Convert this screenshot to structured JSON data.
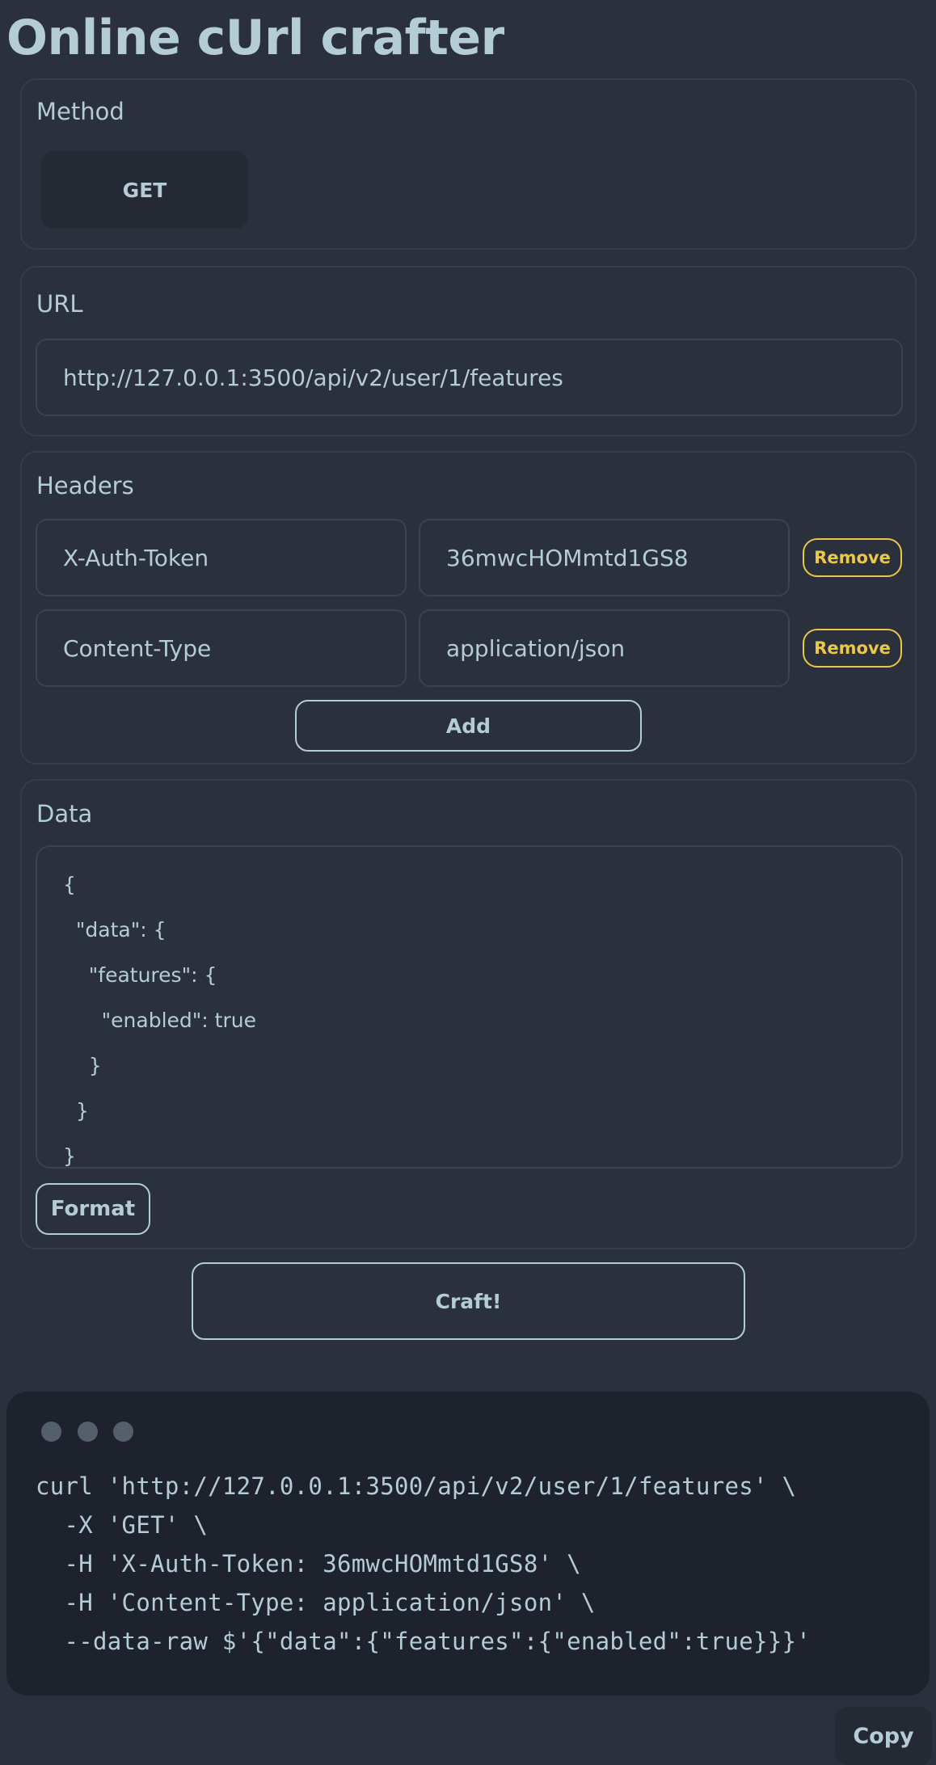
{
  "title": "Online cUrl crafter",
  "method": {
    "label": "Method",
    "selected": "GET"
  },
  "url": {
    "label": "URL",
    "value": "http://127.0.0.1:3500/api/v2/user/1/features"
  },
  "headers": {
    "label": "Headers",
    "rows": [
      {
        "key": "X-Auth-Token",
        "value": "36mwcHOMmtd1GS8",
        "remove_label": "Remove"
      },
      {
        "key": "Content-Type",
        "value": "application/json",
        "remove_label": "Remove"
      }
    ],
    "add_label": "Add"
  },
  "data": {
    "label": "Data",
    "lines": [
      "{",
      "  \"data\": {",
      "    \"features\": {",
      "      \"enabled\": true",
      "    }",
      "  }",
      "}"
    ],
    "format_label": "Format"
  },
  "craft_label": "Craft!",
  "output": {
    "lines": [
      "curl 'http://127.0.0.1:3500/api/v2/user/1/features' \\",
      "  -X 'GET' \\",
      "  -H 'X-Auth-Token: 36mwcHOMmtd1GS8' \\",
      "  -H 'Content-Type: application/json' \\",
      "  --data-raw $'{\"data\":{\"features\":{\"enabled\":true}}}'"
    ],
    "copy_label": "Copy"
  },
  "colors": {
    "background": "#2a303c",
    "text": "#b3ccd6",
    "accent_warning": "#e9c84a",
    "terminal_bg": "#1e222c"
  }
}
